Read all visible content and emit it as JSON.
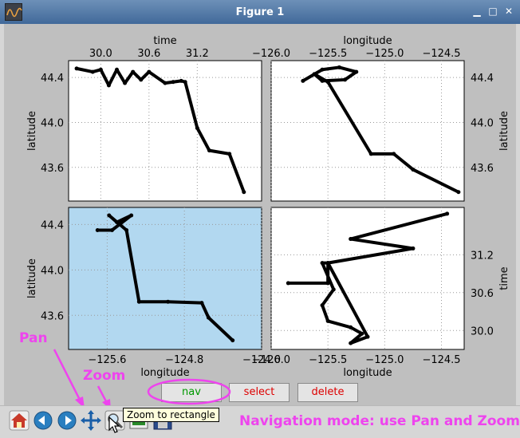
{
  "window": {
    "title": "Figure 1"
  },
  "window_controls": {
    "minimize": "▁",
    "maximize": "□",
    "close": "✕"
  },
  "colors": {
    "annotation": "#ee44ee",
    "highlight_panel": "#b2d8f0",
    "nav": "#009900",
    "select": "#dd0000",
    "delete": "#dd0000"
  },
  "modes": {
    "nav_label": "nav",
    "select_label": "select",
    "delete_label": "delete"
  },
  "toolbar": {
    "icons": [
      "home-icon",
      "back-icon",
      "forward-icon",
      "pan-icon",
      "zoom-icon",
      "configure-icon",
      "save-icon"
    ],
    "tooltip": "Zoom to rectangle"
  },
  "annotations": {
    "pan": "Pan",
    "zoom": "Zoom",
    "message": "Navigation mode: use Pan and Zoom"
  },
  "chart_data": [
    {
      "type": "scatter",
      "panel": "top-left",
      "xlabel": "time",
      "xlabel_position": "top",
      "ylabel": "latitude",
      "ylabel_position": "left",
      "xlim": [
        29.6,
        32.0
      ],
      "ylim": [
        43.3,
        44.55
      ],
      "xticks": [
        30.0,
        30.6,
        31.2
      ],
      "yticks": [
        43.6,
        44.0,
        44.4
      ],
      "highlight": false,
      "x": [
        29.7,
        29.9,
        30.0,
        30.1,
        30.2,
        30.3,
        30.4,
        30.5,
        30.6,
        30.8,
        30.9,
        31.0,
        31.05,
        31.2,
        31.35,
        31.6,
        31.78
      ],
      "y": [
        44.48,
        44.45,
        44.47,
        44.33,
        44.47,
        44.35,
        44.45,
        44.38,
        44.45,
        44.35,
        44.36,
        44.37,
        44.36,
        43.95,
        43.75,
        43.72,
        43.38
      ]
    },
    {
      "type": "scatter",
      "panel": "top-right",
      "xlabel": "longitude",
      "xlabel_position": "top",
      "ylabel": "latitude",
      "ylabel_position": "right",
      "xlim": [
        -126.0,
        -124.3
      ],
      "ylim": [
        43.3,
        44.55
      ],
      "xticks": [
        -126.0,
        -125.5,
        -125.0,
        -124.5
      ],
      "yticks": [
        43.6,
        44.0,
        44.4
      ],
      "highlight": false,
      "x": [
        -125.72,
        -125.55,
        -125.4,
        -125.25,
        -125.35,
        -125.55,
        -125.62,
        -125.5,
        -125.12,
        -124.92,
        -124.75,
        -124.35
      ],
      "y": [
        44.37,
        44.47,
        44.49,
        44.45,
        44.38,
        44.37,
        44.43,
        44.36,
        43.72,
        43.72,
        43.58,
        43.38
      ]
    },
    {
      "type": "scatter",
      "panel": "bottom-left",
      "xlabel": "longitude",
      "xlabel_position": "bottom",
      "ylabel": "latitude",
      "ylabel_position": "left",
      "xlim": [
        -126.0,
        -124.0
      ],
      "ylim": [
        43.3,
        44.55
      ],
      "xticks": [
        -125.6,
        -124.8,
        -124.0
      ],
      "yticks": [
        43.6,
        44.0,
        44.4
      ],
      "highlight": true,
      "x": [
        -125.7,
        -125.55,
        -125.35,
        -125.5,
        -125.58,
        -125.4,
        -125.27,
        -124.97,
        -124.62,
        -124.55,
        -124.3
      ],
      "y": [
        44.35,
        44.35,
        44.48,
        44.42,
        44.48,
        44.35,
        43.72,
        43.72,
        43.71,
        43.58,
        43.38
      ]
    },
    {
      "type": "scatter",
      "panel": "bottom-right",
      "xlabel": "longitude",
      "xlabel_position": "bottom",
      "ylabel": "time",
      "ylabel_position": "right",
      "xlim": [
        -126.0,
        -124.3
      ],
      "ylim": [
        29.7,
        31.95
      ],
      "xticks": [
        -126.0,
        -125.5,
        -125.0,
        -124.5
      ],
      "yticks": [
        30.0,
        30.6,
        31.2
      ],
      "highlight": false,
      "x": [
        -125.85,
        -125.5,
        -125.5,
        -125.55,
        -125.45,
        -125.55,
        -125.5,
        -125.3,
        -125.2,
        -125.3,
        -125.15,
        -125.5,
        -124.75,
        -125.3,
        -124.45
      ],
      "y": [
        30.75,
        30.75,
        31.07,
        31.07,
        30.65,
        30.4,
        30.15,
        30.05,
        29.95,
        29.8,
        29.9,
        31.07,
        31.3,
        31.45,
        31.85
      ]
    }
  ]
}
